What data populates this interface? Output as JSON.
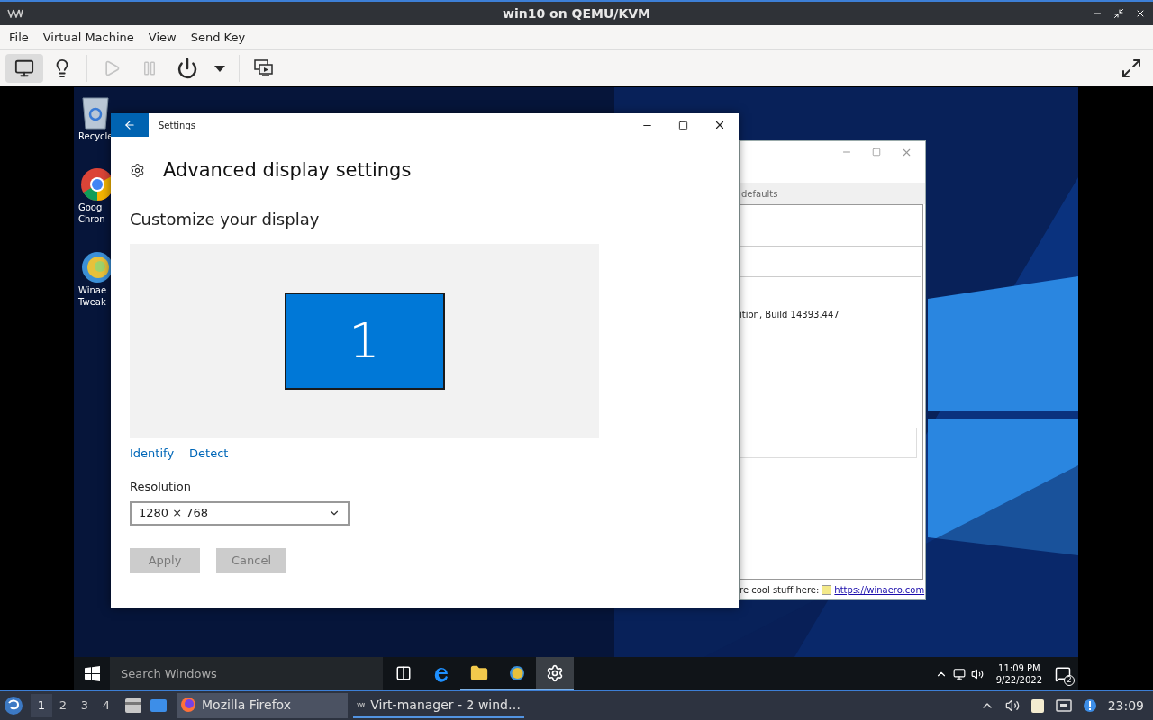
{
  "window": {
    "title": "win10 on QEMU/KVM"
  },
  "menu": [
    "File",
    "Virtual Machine",
    "View",
    "Send Key"
  ],
  "toolbar": [
    {
      "kind": "console",
      "selected": true,
      "disabled": false
    },
    {
      "kind": "details",
      "selected": false,
      "disabled": false
    },
    {
      "kind": "run",
      "selected": false,
      "disabled": true
    },
    {
      "kind": "pause",
      "selected": false,
      "disabled": true
    },
    {
      "kind": "shutdown",
      "selected": false,
      "disabled": false
    },
    {
      "kind": "shutdown_menu",
      "selected": false,
      "disabled": false
    },
    {
      "kind": "snapshots",
      "selected": false,
      "disabled": false
    }
  ],
  "desktop_icons": [
    {
      "kind": "recycle_bin",
      "lines": [
        "Recycle"
      ]
    },
    {
      "kind": "chrome",
      "lines": [
        "Goog",
        "Chron"
      ]
    },
    {
      "kind": "winaero",
      "lines": [
        "Winae",
        "Tweak"
      ]
    }
  ],
  "settings_window": {
    "title": "Settings",
    "heading": "Advanced display settings",
    "section": "Customize your display",
    "monitor_label": "1",
    "links": [
      "Identify",
      "Detect"
    ],
    "resolution": {
      "label": "Resolution",
      "value": "1280 × 768"
    },
    "buttons": [
      {
        "label": "Apply",
        "disabled": true
      },
      {
        "label": "Cancel",
        "disabled": true
      }
    ]
  },
  "back_window": {
    "toolbar_text": "defaults",
    "info_text": "ition, Build 14393.447",
    "status_text": "re cool stuff here:",
    "status_link": "https://winaero.com"
  },
  "guest_taskbar": {
    "search_placeholder": "Search Windows",
    "apps": [
      {
        "kind": "task_view",
        "selected": false,
        "running": false
      },
      {
        "kind": "edge",
        "selected": false,
        "running": false
      },
      {
        "kind": "explorer",
        "selected": false,
        "running": true
      },
      {
        "kind": "winaero",
        "selected": false,
        "running": true
      },
      {
        "kind": "settings",
        "selected": true,
        "running": true
      }
    ],
    "time": "11:09 PM",
    "date": "9/22/2022",
    "notifications": "2"
  },
  "host_panel": {
    "workspaces": [
      {
        "label": "1",
        "selected": true
      },
      {
        "label": "2",
        "selected": false
      },
      {
        "label": "3",
        "selected": false
      },
      {
        "label": "4",
        "selected": false
      }
    ],
    "tasks": [
      {
        "kind": "firefox",
        "label": "Mozilla Firefox",
        "selected": false
      },
      {
        "kind": "virt_manager",
        "label": "Virt-manager - 2 wind…",
        "selected": true
      }
    ],
    "clock": "23:09"
  }
}
